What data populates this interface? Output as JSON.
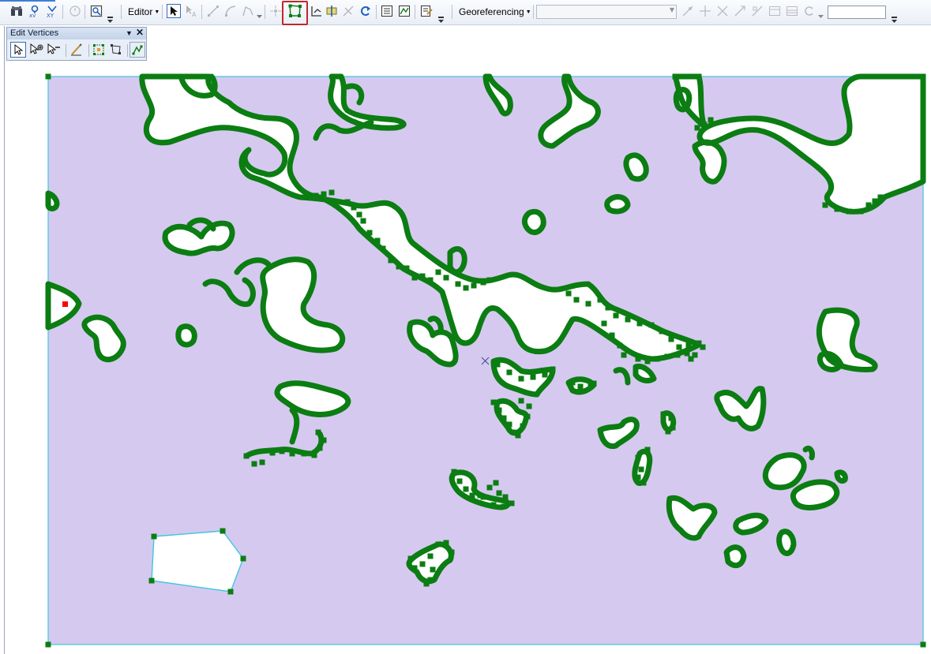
{
  "toolbar": {
    "editor_label": "Editor",
    "georeferencing_label": "Georeferencing",
    "layer_combo_value": "",
    "scale_value": ""
  },
  "edit_vertices_panel": {
    "title": "Edit Vertices",
    "icons": [
      "pointer-icon",
      "add-vertex-icon",
      "delete-vertex-icon",
      "sketch-properties-icon",
      "modify-sketch-icon",
      "reshape-icon",
      "finish-sketch-icon"
    ]
  },
  "map": {
    "polygon_fill": "#d6c9f0",
    "polygon_outline": "#3fc6e0",
    "vertex_color": "#0b7d12",
    "selected_vertex_color": "#ff0000",
    "hole_fill": "#ffffff"
  },
  "colors": {
    "highlight": "#c0272d",
    "active_button_border": "#3a6bb5"
  }
}
